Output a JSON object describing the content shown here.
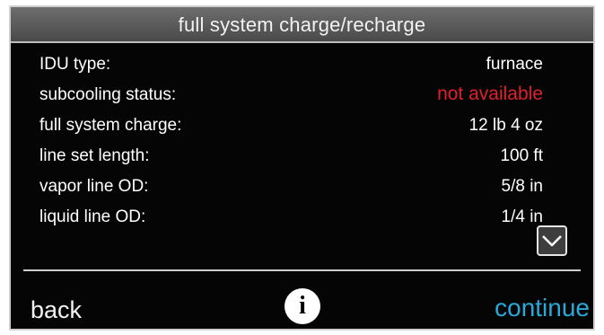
{
  "header": {
    "title": "full system charge/recharge"
  },
  "rows": [
    {
      "label": "IDU type:",
      "value": "furnace"
    },
    {
      "label": "subcooling status:",
      "value": "not available"
    },
    {
      "label": "full system charge:",
      "value": "12 lb 4 oz"
    },
    {
      "label": "line set length:",
      "value": "100 ft"
    },
    {
      "label": "vapor line OD:",
      "value": "5/8 in"
    },
    {
      "label": "liquid line OD:",
      "value": "1/4 in"
    }
  ],
  "footer": {
    "back_label": "back",
    "info_label": "i",
    "continue_label": "continue"
  },
  "colors": {
    "alert": "#e0202a",
    "accent": "#2aa8d8",
    "background": "#050505"
  }
}
